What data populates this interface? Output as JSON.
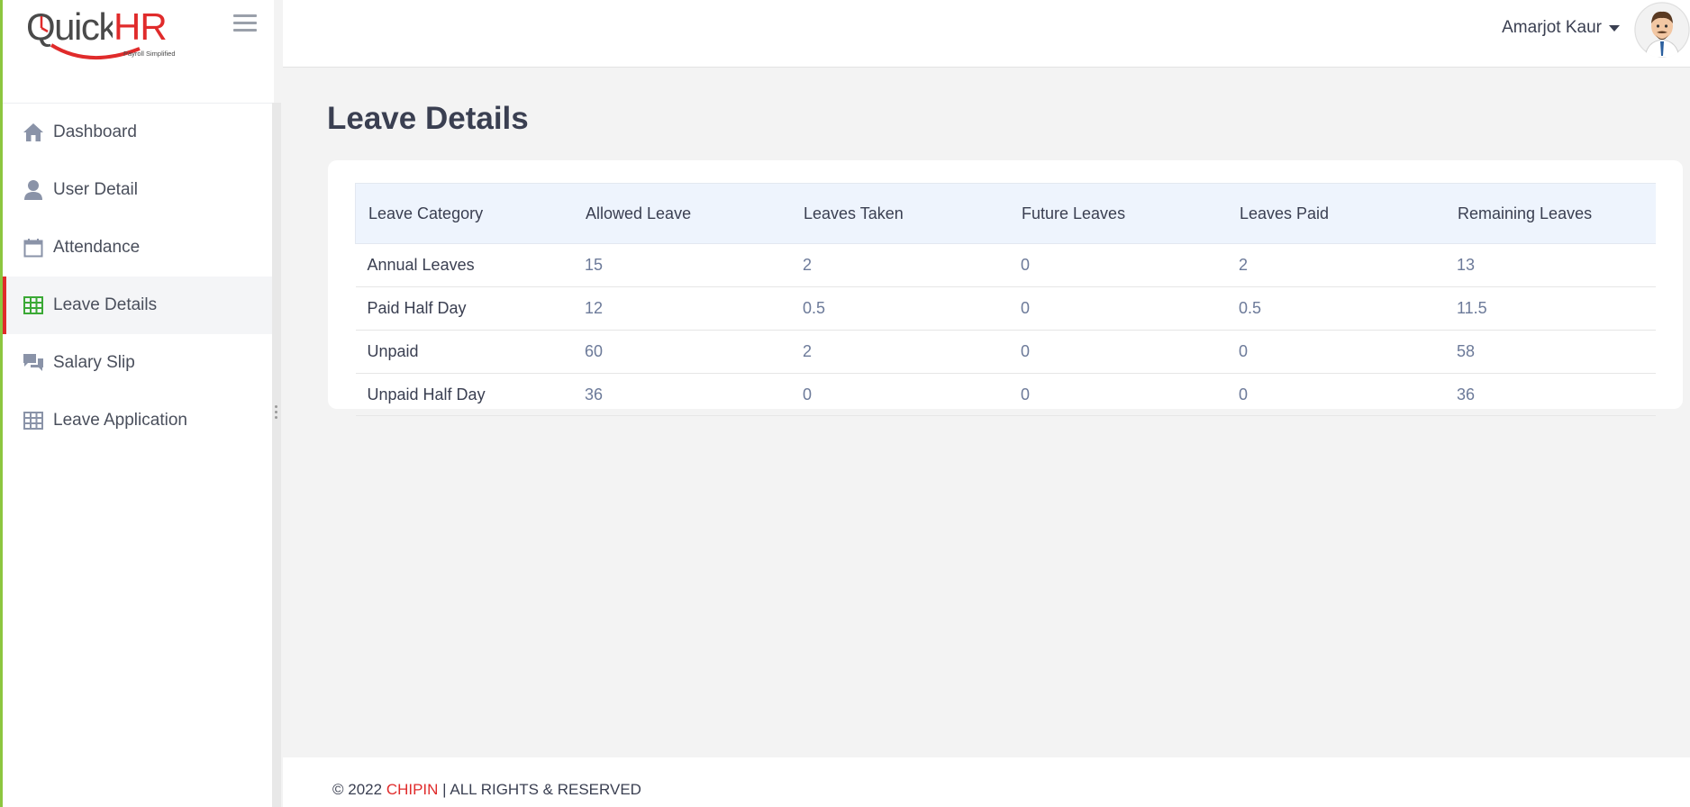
{
  "app": {
    "logo_text": "QuickHR",
    "logo_tagline": "Payroll Simplified"
  },
  "colors": {
    "accent_red": "#e02b2b",
    "accent_green": "#8cc63f",
    "title_color": "#3a3f51",
    "value_color": "#6c7a99"
  },
  "sidebar": {
    "items": [
      {
        "label": "Dashboard",
        "icon": "home-icon",
        "active": false
      },
      {
        "label": "User Detail",
        "icon": "user-icon",
        "active": false
      },
      {
        "label": "Attendance",
        "icon": "calendar-icon",
        "active": false
      },
      {
        "label": "Leave Details",
        "icon": "table-icon",
        "active": true
      },
      {
        "label": "Salary Slip",
        "icon": "chat-icon",
        "active": false
      },
      {
        "label": "Leave Application",
        "icon": "grid-icon",
        "active": false
      }
    ]
  },
  "header": {
    "user_name": "Amarjot Kaur"
  },
  "main": {
    "title": "Leave Details",
    "table": {
      "columns": [
        "Leave Category",
        "Allowed Leave",
        "Leaves Taken",
        "Future Leaves",
        "Leaves Paid",
        "Remaining Leaves"
      ],
      "rows": [
        [
          "Annual Leaves",
          "15",
          "2",
          "0",
          "2",
          "13"
        ],
        [
          "Paid Half Day",
          "12",
          "0.5",
          "0",
          "0.5",
          "11.5"
        ],
        [
          "Unpaid",
          "60",
          "2",
          "0",
          "0",
          "58"
        ],
        [
          "Unpaid Half Day",
          "36",
          "0",
          "0",
          "0",
          "36"
        ]
      ]
    }
  },
  "footer": {
    "copyright": "© 2022",
    "brand": "CHIPIN",
    "rights": "| ALL RIGHTS & RESERVED"
  }
}
